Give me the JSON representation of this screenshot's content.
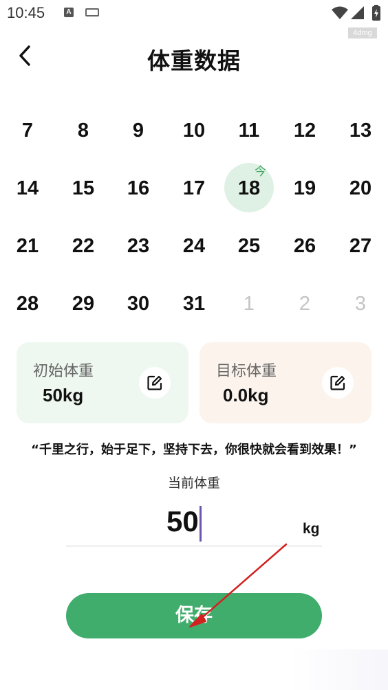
{
  "status_bar": {
    "time": "10:45",
    "watermark": "4dmg"
  },
  "header": {
    "title": "体重数据"
  },
  "calendar": {
    "rows": [
      [
        "7",
        "8",
        "9",
        "10",
        "11",
        "12",
        "13"
      ],
      [
        "14",
        "15",
        "16",
        "17",
        "18",
        "19",
        "20"
      ],
      [
        "21",
        "22",
        "23",
        "24",
        "25",
        "26",
        "27"
      ],
      [
        "28",
        "29",
        "30",
        "31",
        "1",
        "2",
        "3"
      ]
    ],
    "today_day": "18",
    "today_mark": "今"
  },
  "cards": {
    "initial": {
      "label": "初始体重",
      "value": "50kg"
    },
    "target": {
      "label": "目标体重",
      "value": "0.0kg"
    }
  },
  "quote": "“千里之行，始于足下，坚持下去，你很快就会看到效果！”",
  "current": {
    "label": "当前体重",
    "value": "50",
    "unit": "kg"
  },
  "save_label": "保存",
  "colors": {
    "accent": "#40ad6c",
    "today_bg": "#dff1e4",
    "initial_card_bg": "#eef8f0",
    "target_card_bg": "#fbf3ec",
    "arrow": "#d32020"
  }
}
